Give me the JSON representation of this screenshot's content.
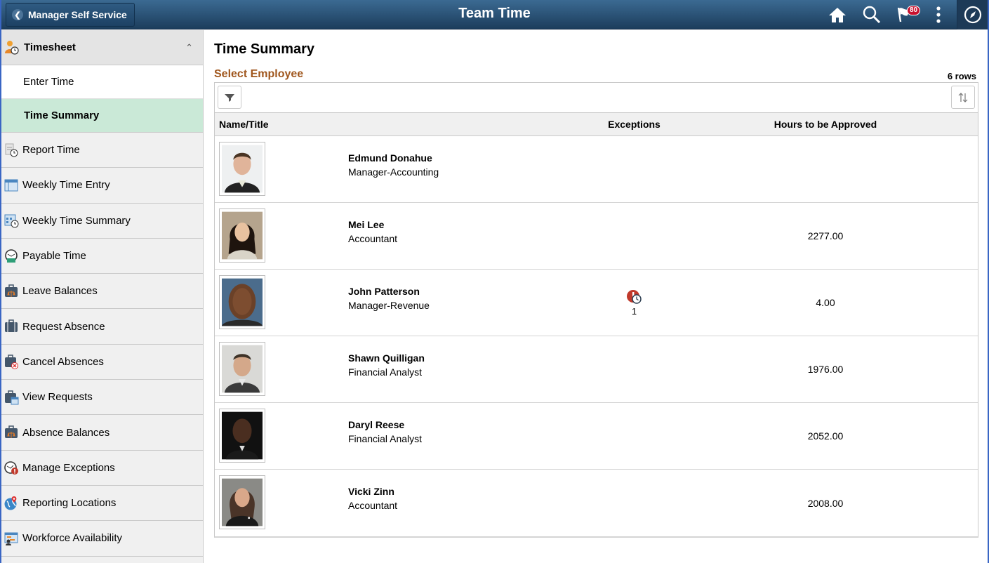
{
  "header": {
    "back_label": "Manager Self Service",
    "title": "Team Time",
    "notification_count": "80",
    "icons": [
      "home-icon",
      "search-icon",
      "notifications-flag-icon",
      "actions-menu-icon",
      "navbar-compass-icon"
    ]
  },
  "sidebar": {
    "group": {
      "label": "Timesheet",
      "icon": "timesheet-person-clock-icon",
      "expanded": true
    },
    "sub_items": [
      {
        "label": "Enter Time",
        "active": false
      },
      {
        "label": "Time Summary",
        "active": true
      }
    ],
    "items": [
      {
        "label": "Report Time",
        "icon": "report-time-icon"
      },
      {
        "label": "Weekly Time Entry",
        "icon": "weekly-entry-icon"
      },
      {
        "label": "Weekly Time Summary",
        "icon": "weekly-summary-calendar-icon"
      },
      {
        "label": "Payable Time",
        "icon": "payable-time-clock-icon"
      },
      {
        "label": "Leave Balances",
        "icon": "leave-balances-briefcase-icon"
      },
      {
        "label": "Request Absence",
        "icon": "briefcase-icon"
      },
      {
        "label": "Cancel Absences",
        "icon": "briefcase-cancel-icon"
      },
      {
        "label": "View Requests",
        "icon": "briefcase-calendar-icon"
      },
      {
        "label": "Absence Balances",
        "icon": "absence-balances-briefcase-icon"
      },
      {
        "label": "Manage Exceptions",
        "icon": "clock-exception-icon"
      },
      {
        "label": "Reporting Locations",
        "icon": "globe-pin-icon"
      },
      {
        "label": "Workforce Availability",
        "icon": "workforce-availability-icon"
      }
    ]
  },
  "main": {
    "page_title": "Time Summary",
    "section_title": "Select Employee",
    "row_count": "6 rows",
    "columns": {
      "name": "Name/Title",
      "exceptions": "Exceptions",
      "hours": "Hours to be Approved"
    },
    "rows": [
      {
        "name": "Edmund Donahue",
        "title": "Manager-Accounting",
        "exceptions": "",
        "hours": ""
      },
      {
        "name": "Mei Lee",
        "title": "Accountant",
        "exceptions": "",
        "hours": "2277.00"
      },
      {
        "name": "John Patterson",
        "title": "Manager-Revenue",
        "exceptions": "1",
        "hours": "4.00"
      },
      {
        "name": "Shawn Quilligan",
        "title": "Financial Analyst",
        "exceptions": "",
        "hours": "1976.00"
      },
      {
        "name": "Daryl Reese",
        "title": "Financial Analyst",
        "exceptions": "",
        "hours": "2052.00"
      },
      {
        "name": "Vicki Zinn",
        "title": "Accountant",
        "exceptions": "",
        "hours": "2008.00"
      }
    ]
  },
  "colors": {
    "header_top": "#3b6a92",
    "header_bottom": "#1c3d5c",
    "active_item": "#cae9d7",
    "section_title": "#a0571e",
    "badge": "#c8102e",
    "exception_red": "#c0392b"
  }
}
